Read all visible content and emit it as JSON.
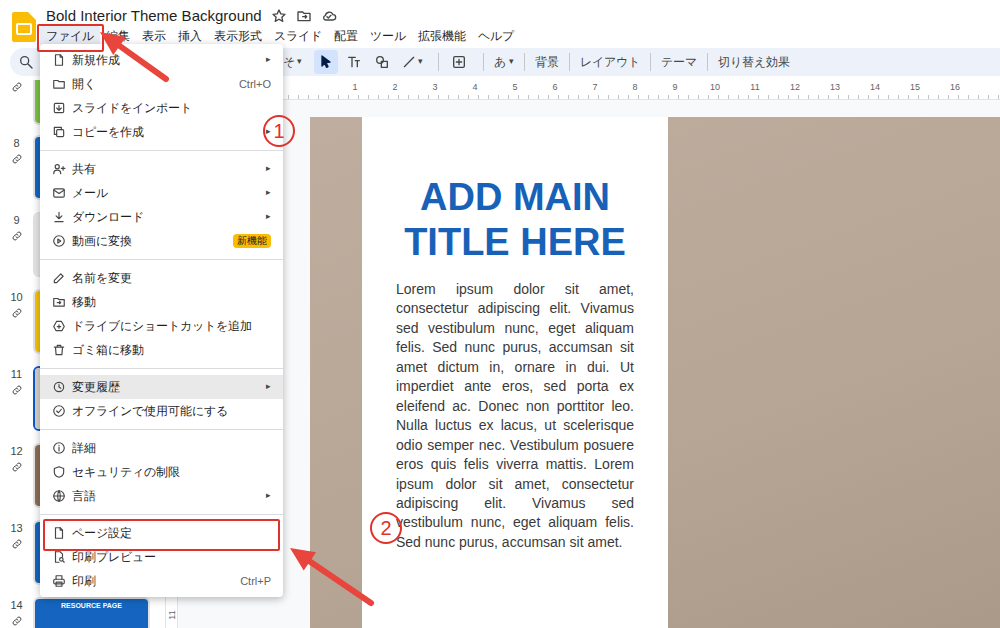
{
  "window": {
    "title": "Bold Interior Theme Background"
  },
  "menubar": [
    {
      "label": "ファイル",
      "selected": true
    },
    {
      "label": "編集",
      "selected": false
    },
    {
      "label": "表示",
      "selected": false
    },
    {
      "label": "挿入",
      "selected": false
    },
    {
      "label": "表示形式",
      "selected": false
    },
    {
      "label": "スライド",
      "selected": false
    },
    {
      "label": "配置",
      "selected": false
    },
    {
      "label": "ツール",
      "selected": false
    },
    {
      "label": "拡張機能",
      "selected": false
    },
    {
      "label": "ヘルプ",
      "selected": false
    }
  ],
  "toolbar": {
    "zoom_fragment": "そ",
    "caret": "▾",
    "tools": [
      {
        "kind": "select",
        "selected": true,
        "dropdown": false
      },
      {
        "kind": "textbox",
        "selected": false,
        "dropdown": false
      },
      {
        "kind": "shape",
        "selected": false,
        "dropdown": false
      },
      {
        "kind": "line",
        "selected": false,
        "dropdown": true
      },
      {
        "kind": "insert",
        "selected": false,
        "dropdown": false
      }
    ],
    "text_buttons": [
      {
        "label": "あ",
        "dropdown": true
      },
      {
        "label": "背景",
        "dropdown": false
      },
      {
        "label": "レイアウト",
        "dropdown": false
      },
      {
        "label": "テーマ",
        "dropdown": false
      },
      {
        "label": "切り替え効果",
        "dropdown": false
      }
    ]
  },
  "filmstrip": {
    "cut_top_color": "#7cc242",
    "slides": [
      {
        "number": "8",
        "selected": false,
        "color": "#1565c0"
      },
      {
        "number": "9",
        "selected": false,
        "color": "#e6e6e6"
      },
      {
        "number": "10",
        "selected": false,
        "color": "#f4c20d"
      },
      {
        "number": "11",
        "selected": true,
        "color": "#d9d2ca"
      },
      {
        "number": "12",
        "selected": false,
        "color": "#8d6e55"
      },
      {
        "number": "13",
        "selected": false,
        "color": "#1565c0"
      },
      {
        "number": "14",
        "selected": false,
        "color": "#1565c0",
        "caption": "RESOURCE PAGE"
      }
    ]
  },
  "rulers": {
    "top": [
      "1",
      "2",
      "3",
      "4",
      "5",
      "6",
      "7",
      "8",
      "9",
      "10",
      "11",
      "12",
      "13",
      "14",
      "15",
      "16"
    ],
    "left": [
      "11"
    ]
  },
  "slide": {
    "title_lines": [
      "ADD MAIN",
      "TITLE HERE"
    ],
    "body": "Lorem ipsum dolor sit amet, consectetur adipiscing elit. Vivamus sed vestibulum nunc, eget aliquam felis. Sed nunc purus, accumsan sit amet dictum in, ornare in dui. Ut imperdiet ante eros, sed porta ex eleifend ac. Donec non porttitor leo. Nulla luctus ex lacus, ut scelerisque odio semper nec. Vestibulum posuere eros quis felis viverra mattis. Lorem ipsum dolor sit amet, consectetur adipiscing elit. Vivamus sed vestibulum nunc, eget aliquam felis. Sed nunc purus, accumsan sit amet."
  },
  "file_menu": {
    "arrow": "▸",
    "groups": [
      [
        {
          "label": "新規作成",
          "submenu": true,
          "highlighted": false
        },
        {
          "label": "開く",
          "shortcut": "Ctrl+O",
          "submenu": false,
          "highlighted": false
        },
        {
          "label": "スライドをインポート",
          "submenu": false,
          "highlighted": false
        },
        {
          "label": "コピーを作成",
          "submenu": true,
          "highlighted": false
        }
      ],
      [
        {
          "label": "共有",
          "submenu": true,
          "highlighted": false
        },
        {
          "label": "メール",
          "submenu": true,
          "highlighted": false
        },
        {
          "label": "ダウンロード",
          "submenu": true,
          "highlighted": false
        },
        {
          "label": "動画に変換",
          "badge": "新機能",
          "submenu": false,
          "highlighted": false
        }
      ],
      [
        {
          "label": "名前を変更",
          "submenu": false,
          "highlighted": false
        },
        {
          "label": "移動",
          "submenu": false,
          "highlighted": false
        },
        {
          "label": "ドライブにショートカットを追加",
          "submenu": false,
          "highlighted": false
        },
        {
          "label": "ゴミ箱に移動",
          "submenu": false,
          "highlighted": false
        }
      ],
      [
        {
          "label": "変更履歴",
          "submenu": true,
          "highlighted": true
        },
        {
          "label": "オフラインで使用可能にする",
          "submenu": false,
          "highlighted": false
        }
      ],
      [
        {
          "label": "詳細",
          "submenu": false,
          "highlighted": false
        },
        {
          "label": "セキュリティの制限",
          "submenu": false,
          "highlighted": false
        },
        {
          "label": "言語",
          "submenu": true,
          "highlighted": false
        }
      ],
      [
        {
          "label": "ページ設定",
          "submenu": false,
          "highlighted": false
        },
        {
          "label": "印刷プレビュー",
          "submenu": false,
          "highlighted": false
        },
        {
          "label": "印刷",
          "shortcut": "Ctrl+P",
          "submenu": false,
          "highlighted": false
        }
      ]
    ]
  },
  "annotations": {
    "badges": [
      {
        "label": "1"
      },
      {
        "label": "2"
      }
    ]
  }
}
